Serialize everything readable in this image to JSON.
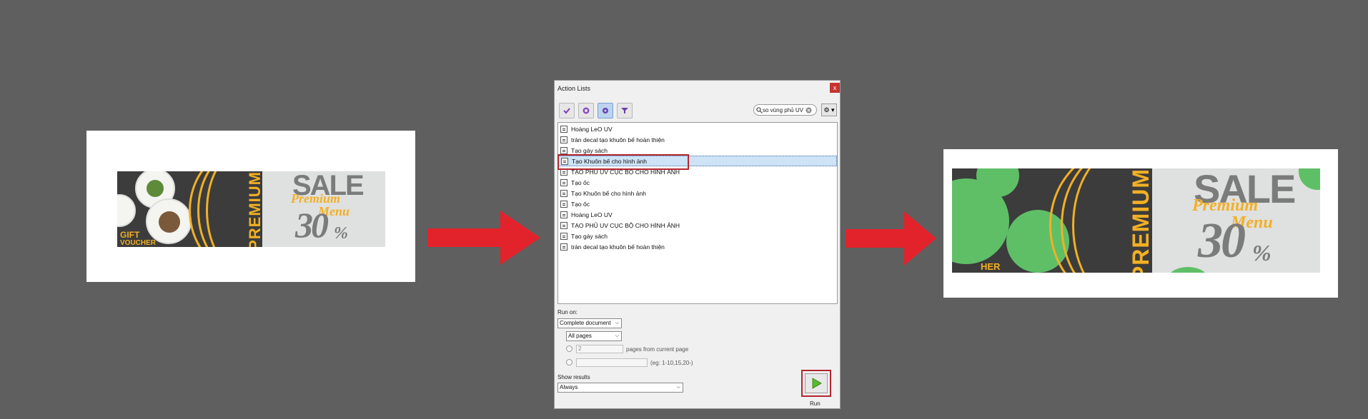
{
  "before_banner": {
    "premium": "PREMIUM",
    "gift_line1": "GIFT",
    "gift_line2": "VOUCHER",
    "sale": "SALE",
    "script_line1": "Premium",
    "script_line2": "Menu",
    "number": "30",
    "percent": "%"
  },
  "after_banner": {
    "premium": "PREMIUM",
    "gift_fragment": "HER",
    "sale": "SALE",
    "script_line1": "Premium",
    "script_line2": "Menu",
    "number": "30",
    "percent": "%"
  },
  "dialog": {
    "title": "Action Lists",
    "close": "x",
    "search_value": "so vùng phủ UV",
    "gear": "⚙ ▾",
    "items": [
      "Hoàng LeO UV",
      "tràn decal tạo khuôn bế hoàn thiện",
      "Tạo gáy sách",
      "Tạo Khuôn bế cho hình ảnh",
      "TẠO PHỦ UV CỤC BỘ CHO HÌNH ẢNH",
      "Tạo ốc",
      "Tạo Khuôn bế cho hình ảnh",
      "Tạo ốc",
      "Hoàng LeO UV",
      "TẠO PHỦ UV CỤC BỘ CHO HÌNH ẢNH",
      "Tạo gáy sách",
      "tràn decal tạo khuôn bế hoàn thiện"
    ],
    "run_on_label": "Run on:",
    "run_on_value": "Complete document",
    "pages_value": "All pages",
    "pages_count": "2",
    "pages_from_label": "pages from current page",
    "range_hint": "(eg: 1-10,15,20-)",
    "show_results_label": "Show results",
    "show_results_value": "Always",
    "run_label": "Run"
  },
  "colors": {
    "background": "#5f5f5f",
    "arrow": "#e3232b",
    "highlight": "#b3262f",
    "accent_yellow": "#f2b025",
    "uv_green": "#5fbf67"
  }
}
